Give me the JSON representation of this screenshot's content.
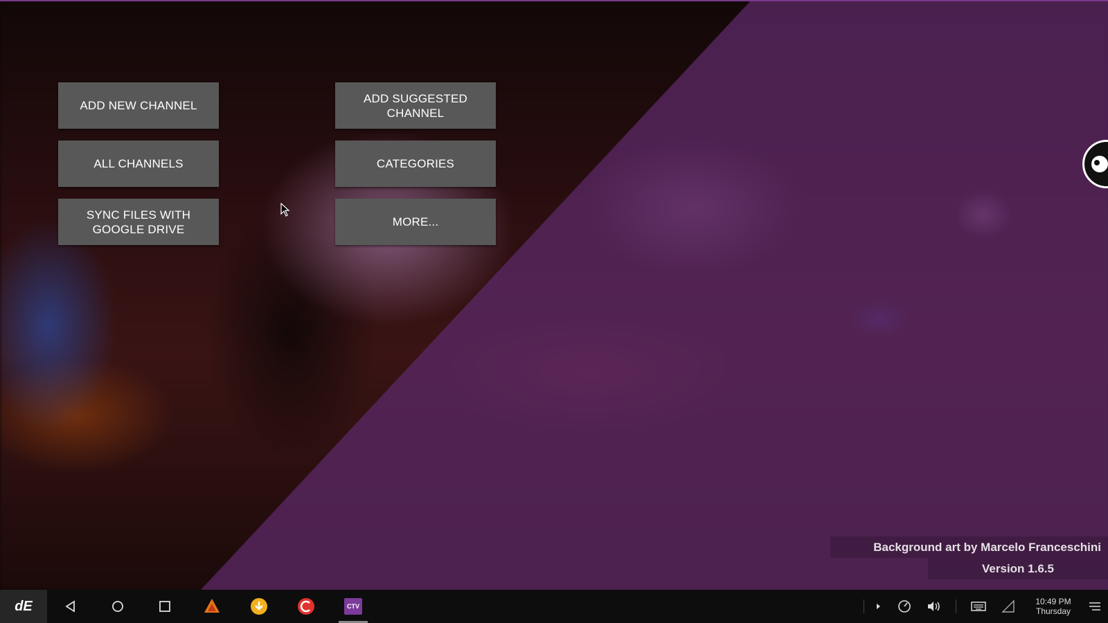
{
  "menu": {
    "add_new_channel": "ADD NEW CHANNEL",
    "add_suggested_channel": "ADD SUGGESTED\nCHANNEL",
    "all_channels": "ALL CHANNELS",
    "categories": "CATEGORIES",
    "sync_files": "SYNC FILES WITH\nGOOGLE DRIVE",
    "more": "MORE..."
  },
  "credits": {
    "background_art": "Background art by Marcelo Franceschini",
    "version": "Version 1.6.5"
  },
  "taskbar": {
    "start_label": "dE",
    "ctv_label": "CTV",
    "clock_time": "10:49 PM",
    "clock_day": "Thursday"
  },
  "colors": {
    "button_bg": "#585858",
    "overlay": "#5a2864",
    "taskbar": "#0d0d0d"
  }
}
